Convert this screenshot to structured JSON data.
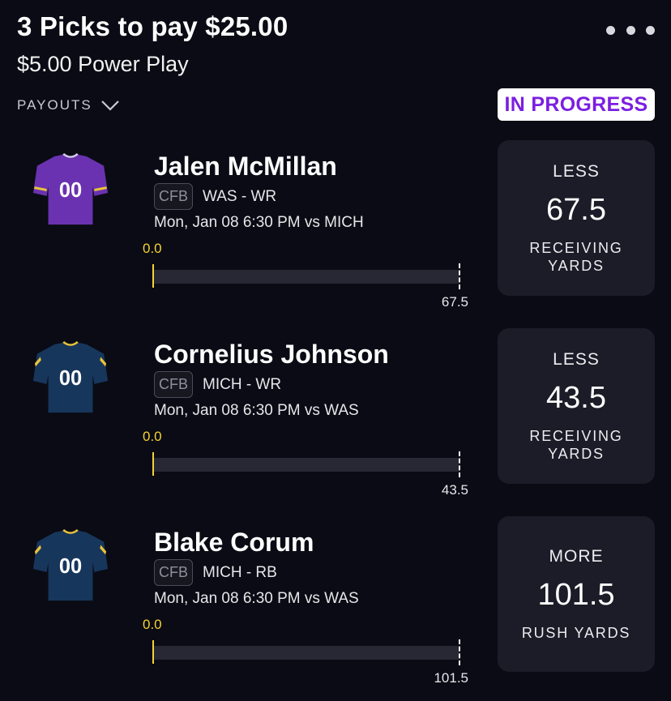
{
  "header": {
    "title": "3 Picks to pay $25.00",
    "subtitle": "$5.00 Power Play",
    "payouts_label": "PAYOUTS",
    "status": "IN PROGRESS"
  },
  "colors": {
    "background": "#0a0b14",
    "card": "#1b1c27",
    "status_text": "#7b1fe0",
    "progress": "#f6d232",
    "jersey_purple": "#6a32b0",
    "jersey_navy": "#17365c",
    "jersey_trim_gold": "#e8c43a"
  },
  "picks": [
    {
      "player": "Jalen McMillan",
      "league": "CFB",
      "team_pos": "WAS - WR",
      "game": "Mon, Jan 08 6:30 PM  vs MICH",
      "progress_value": "0.0",
      "progress_fraction": 0,
      "line_label": "67.5",
      "direction": "LESS",
      "line": "67.5",
      "stat": "RECEIVING\nYARDS",
      "jersey_number": "00",
      "jersey_icon": "jersey-purple-icon"
    },
    {
      "player": "Cornelius Johnson",
      "league": "CFB",
      "team_pos": "MICH - WR",
      "game": "Mon, Jan 08 6:30 PM  vs WAS",
      "progress_value": "0.0",
      "progress_fraction": 0,
      "line_label": "43.5",
      "direction": "LESS",
      "line": "43.5",
      "stat": "RECEIVING\nYARDS",
      "jersey_number": "00",
      "jersey_icon": "jersey-navy-icon"
    },
    {
      "player": "Blake Corum",
      "league": "CFB",
      "team_pos": "MICH - RB",
      "game": "Mon, Jan 08 6:30 PM  vs WAS",
      "progress_value": "0.0",
      "progress_fraction": 0,
      "line_label": "101.5",
      "direction": "MORE",
      "line": "101.5",
      "stat": "RUSH YARDS",
      "jersey_number": "00",
      "jersey_icon": "jersey-navy-icon"
    }
  ]
}
